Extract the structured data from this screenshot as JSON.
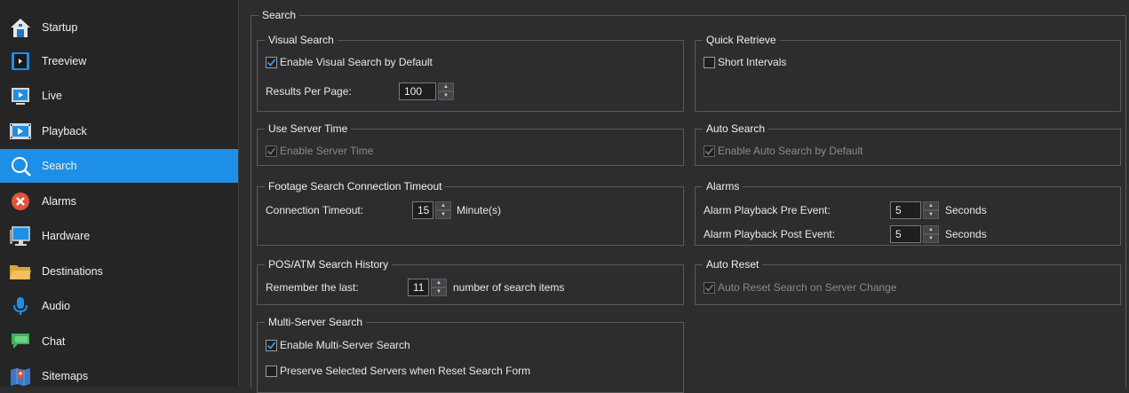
{
  "sidebar": {
    "items": [
      {
        "label": "Startup",
        "icon": "home-icon"
      },
      {
        "label": "Treeview",
        "icon": "treeview-icon"
      },
      {
        "label": "Live",
        "icon": "live-icon"
      },
      {
        "label": "Playback",
        "icon": "playback-icon"
      },
      {
        "label": "Search",
        "icon": "search-icon",
        "active": true
      },
      {
        "label": "Alarms",
        "icon": "alarm-icon"
      },
      {
        "label": "Hardware",
        "icon": "monitor-icon"
      },
      {
        "label": "Destinations",
        "icon": "folder-icon"
      },
      {
        "label": "Audio",
        "icon": "microphone-icon"
      },
      {
        "label": "Chat",
        "icon": "chat-icon"
      },
      {
        "label": "Sitemaps",
        "icon": "map-icon"
      }
    ],
    "active_color": "#1e8fe6"
  },
  "search": {
    "title": "Search",
    "visual_search": {
      "title": "Visual Search",
      "enable_label": "Enable Visual Search by Default",
      "enable_checked": true,
      "results_label": "Results Per Page:",
      "results_value": "100"
    },
    "use_server_time": {
      "title": "Use Server Time",
      "enable_label": "Enable Server Time",
      "enable_checked": true,
      "disabled": true
    },
    "footage_timeout": {
      "title": "Footage Search Connection Timeout",
      "label": "Connection Timeout:",
      "value": "15",
      "unit": "Minute(s)"
    },
    "pos_atm": {
      "title": "POS/ATM Search History",
      "label": "Remember the last:",
      "value": "11",
      "unit": "number of search items"
    },
    "multi_server": {
      "title": "Multi-Server Search",
      "enable_label": "Enable Multi-Server Search",
      "enable_checked": true,
      "preserve_label": "Preserve Selected Servers when Reset Search Form",
      "preserve_checked": false
    },
    "quick_retrieve": {
      "title": "Quick Retrieve",
      "short_label": "Short Intervals",
      "short_checked": false
    },
    "auto_search": {
      "title": "Auto Search",
      "enable_label": "Enable Auto Search by Default",
      "enable_checked": true,
      "disabled": true
    },
    "alarms": {
      "title": "Alarms",
      "pre_label": "Alarm Playback Pre Event:",
      "pre_value": "5",
      "post_label": "Alarm Playback Post Event:",
      "post_value": "5",
      "unit": "Seconds"
    },
    "auto_reset": {
      "title": "Auto Reset",
      "label": "Auto Reset Search on Server Change",
      "checked": true,
      "disabled": true
    }
  }
}
